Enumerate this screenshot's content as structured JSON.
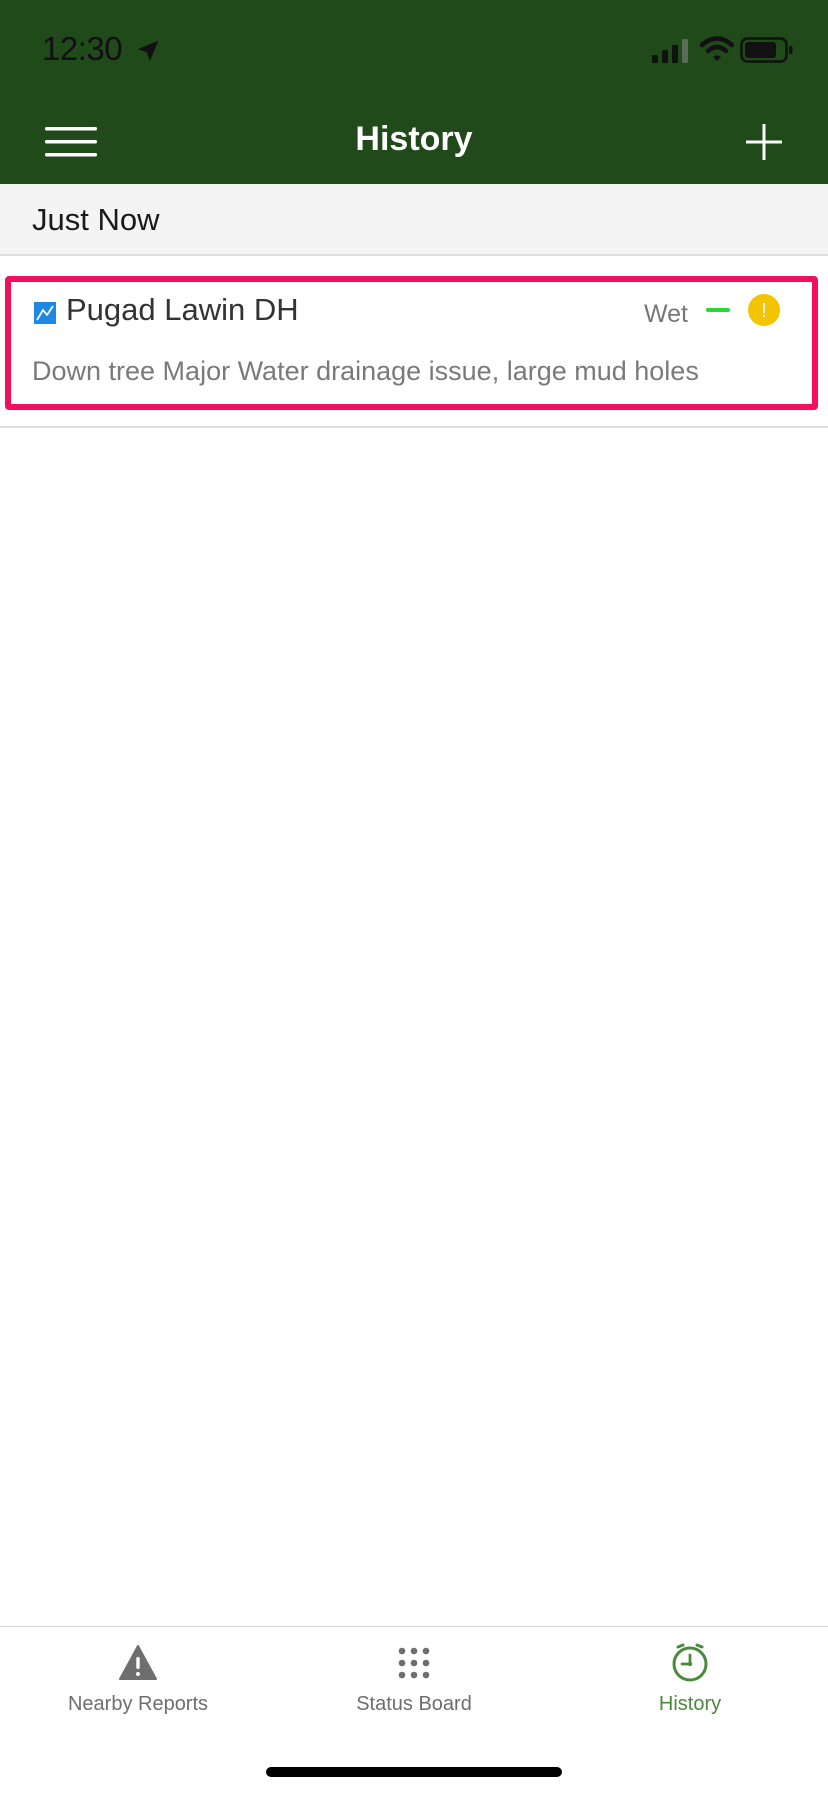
{
  "status_bar": {
    "time": "12:30"
  },
  "nav": {
    "title": "History"
  },
  "section": {
    "title": "Just Now"
  },
  "report": {
    "trail_name": "Pugad Lawin DH",
    "condition": "Wet",
    "description": "Down tree Major Water drainage issue, large mud holes",
    "alert_glyph": "!"
  },
  "tabs": [
    {
      "label": "Nearby Reports",
      "icon": "warning-triangle-icon"
    },
    {
      "label": "Status Board",
      "icon": "grid-dots-icon"
    },
    {
      "label": "History",
      "icon": "clock-icon",
      "active": true
    }
  ],
  "colors": {
    "header_bg": "#204a1a",
    "highlight": "#f2105e",
    "trail_icon": "#1e88e5",
    "trend_green": "#2ad92a",
    "alert_yellow": "#f5c400",
    "active_tab": "#4a8a3a"
  }
}
